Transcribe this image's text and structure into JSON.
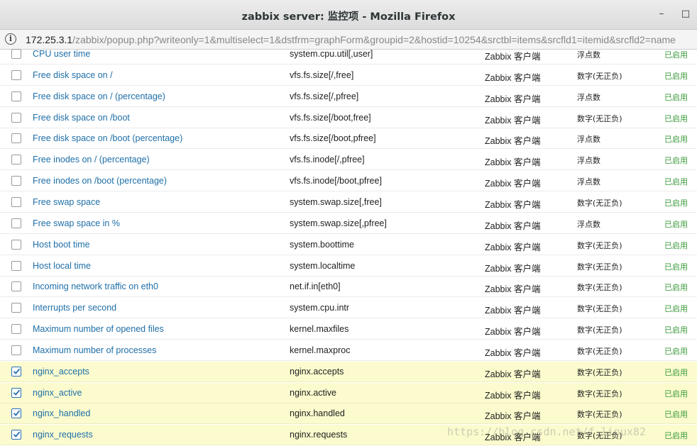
{
  "window": {
    "title": "zabbix server: 监控项 - Mozilla Firefox",
    "minimize_glyph": "–",
    "maximize_glyph": "□"
  },
  "address_bar": {
    "host": "172.25.3.1",
    "path": "/zabbix/popup.php?writeonly=1&multiselect=1&dstfrm=graphForm&groupid=2&hostid=10254&srctbl=items&srcfld1=itemid&srcfld2=name"
  },
  "items": [
    {
      "name": "CPU user time",
      "key": "system.cpu.util[,user]",
      "type": "Zabbix 客户端",
      "format": "浮点数",
      "status": "已启用",
      "checked": false
    },
    {
      "name": "Free disk space on /",
      "key": "vfs.fs.size[/,free]",
      "type": "Zabbix 客户端",
      "format": "数字(无正负)",
      "status": "已启用",
      "checked": false
    },
    {
      "name": "Free disk space on / (percentage)",
      "key": "vfs.fs.size[/,pfree]",
      "type": "Zabbix 客户端",
      "format": "浮点数",
      "status": "已启用",
      "checked": false
    },
    {
      "name": "Free disk space on /boot",
      "key": "vfs.fs.size[/boot,free]",
      "type": "Zabbix 客户端",
      "format": "数字(无正负)",
      "status": "已启用",
      "checked": false
    },
    {
      "name": "Free disk space on /boot (percentage)",
      "key": "vfs.fs.size[/boot,pfree]",
      "type": "Zabbix 客户端",
      "format": "浮点数",
      "status": "已启用",
      "checked": false
    },
    {
      "name": "Free inodes on / (percentage)",
      "key": "vfs.fs.inode[/,pfree]",
      "type": "Zabbix 客户端",
      "format": "浮点数",
      "status": "已启用",
      "checked": false
    },
    {
      "name": "Free inodes on /boot (percentage)",
      "key": "vfs.fs.inode[/boot,pfree]",
      "type": "Zabbix 客户端",
      "format": "浮点数",
      "status": "已启用",
      "checked": false
    },
    {
      "name": "Free swap space",
      "key": "system.swap.size[,free]",
      "type": "Zabbix 客户端",
      "format": "数字(无正负)",
      "status": "已启用",
      "checked": false
    },
    {
      "name": "Free swap space in %",
      "key": "system.swap.size[,pfree]",
      "type": "Zabbix 客户端",
      "format": "浮点数",
      "status": "已启用",
      "checked": false
    },
    {
      "name": "Host boot time",
      "key": "system.boottime",
      "type": "Zabbix 客户端",
      "format": "数字(无正负)",
      "status": "已启用",
      "checked": false
    },
    {
      "name": "Host local time",
      "key": "system.localtime",
      "type": "Zabbix 客户端",
      "format": "数字(无正负)",
      "status": "已启用",
      "checked": false
    },
    {
      "name": "Incoming network traffic on eth0",
      "key": "net.if.in[eth0]",
      "type": "Zabbix 客户端",
      "format": "数字(无正负)",
      "status": "已启用",
      "checked": false
    },
    {
      "name": "Interrupts per second",
      "key": "system.cpu.intr",
      "type": "Zabbix 客户端",
      "format": "数字(无正负)",
      "status": "已启用",
      "checked": false
    },
    {
      "name": "Maximum number of opened files",
      "key": "kernel.maxfiles",
      "type": "Zabbix 客户端",
      "format": "数字(无正负)",
      "status": "已启用",
      "checked": false
    },
    {
      "name": "Maximum number of processes",
      "key": "kernel.maxproc",
      "type": "Zabbix 客户端",
      "format": "数字(无正负)",
      "status": "已启用",
      "checked": false
    },
    {
      "name": "nginx_accepts",
      "key": "nginx.accepts",
      "type": "Zabbix 客户端",
      "format": "数字(无正负)",
      "status": "已启用",
      "checked": true
    },
    {
      "name": "nginx_active",
      "key": "nginx.active",
      "type": "Zabbix 客户端",
      "format": "数字(无正负)",
      "status": "已启用",
      "checked": true
    },
    {
      "name": "nginx_handled",
      "key": "nginx.handled",
      "type": "Zabbix 客户端",
      "format": "数字(无正负)",
      "status": "已启用",
      "checked": true
    },
    {
      "name": "nginx_requests",
      "key": "nginx.requests",
      "type": "Zabbix 客户端",
      "format": "数字(无正负)",
      "status": "已启用",
      "checked": true
    }
  ],
  "watermark": "https://blog.csdn.net/f_linux82",
  "colors": {
    "link": "#1f6fa8",
    "enabled_status": "#3a9a3a",
    "selected_row": "#fbfbce",
    "checkbox_accent": "#2b6fb3"
  }
}
